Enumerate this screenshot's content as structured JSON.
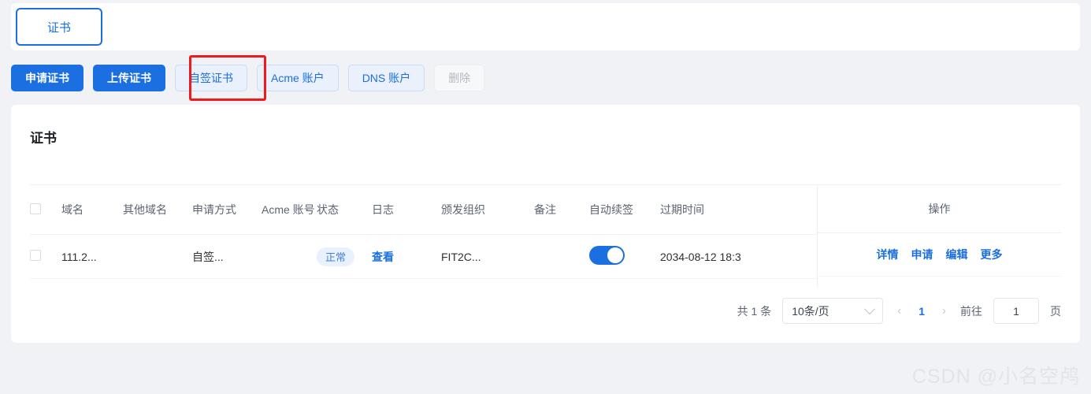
{
  "tabs": [
    {
      "label": "证书",
      "active": true
    }
  ],
  "toolbar": {
    "buttons": [
      {
        "label": "申请证书",
        "style": "primary"
      },
      {
        "label": "上传证书",
        "style": "primary"
      },
      {
        "label": "自签证书",
        "style": "light",
        "highlighted": true
      },
      {
        "label": "Acme 账户",
        "style": "light"
      },
      {
        "label": "DNS 账户",
        "style": "light"
      },
      {
        "label": "删除",
        "style": "disabled"
      }
    ],
    "highlight_color": "#ef1b1b"
  },
  "card": {
    "title": "证书"
  },
  "table": {
    "headers": {
      "domain": "域名",
      "other_domains": "其他域名",
      "apply_method": "申请方式",
      "acme_account": "Acme 账号",
      "status": "状态",
      "log": "日志",
      "issuer": "颁发组织",
      "remark": "备注",
      "auto_renew": "自动续签",
      "expire_time": "过期时间",
      "operation": "操作"
    },
    "rows": [
      {
        "domain": "111.2...",
        "other_domains": "",
        "apply_method": "自签...",
        "acme_account": "",
        "status": "正常",
        "log": "查看",
        "issuer": "FIT2C...",
        "remark": "",
        "auto_renew": true,
        "expire_time": "2034-08-12 18:3",
        "actions": [
          "详情",
          "申请",
          "编辑",
          "更多"
        ]
      }
    ]
  },
  "pagination": {
    "total_text": "共 1 条",
    "page_size": "10条/页",
    "prev_icon": "‹",
    "next_icon": "›",
    "current_page": "1",
    "jump_label": "前往",
    "jump_value": "1",
    "jump_suffix": "页"
  },
  "watermark": {
    "text": "CSDN @小名空鸬"
  },
  "colors": {
    "accent": "#1b6fe0",
    "page_bg": "#f0f2f5",
    "card_bg": "#ffffff",
    "highlight": "#ef1b1b"
  }
}
